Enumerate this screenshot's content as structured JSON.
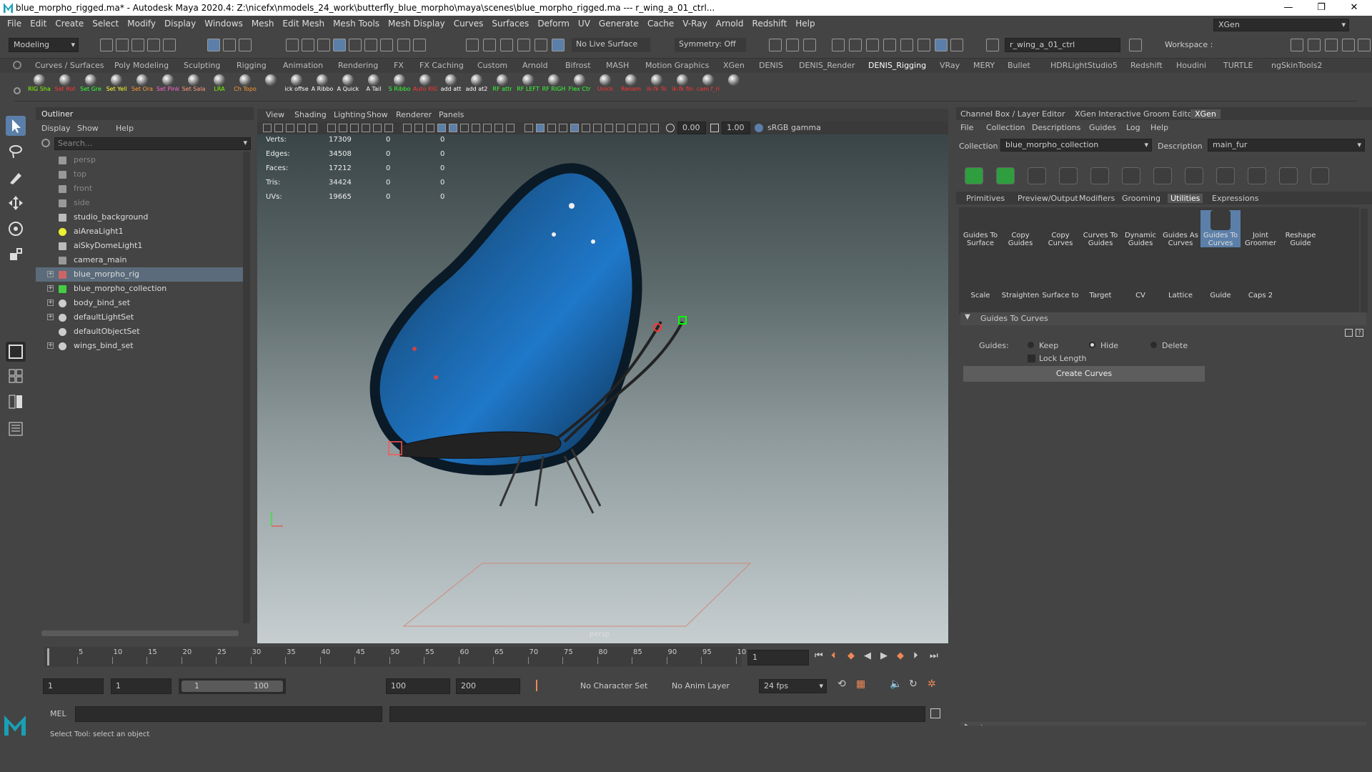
{
  "window": {
    "title": "blue_morpho_rigged.ma* - Autodesk Maya 2020.4: Z:\\nicefx\\nmodels_24_work\\butterfly_blue_morpho\\maya\\scenes\\blue_morpho_rigged.ma  ---  r_wing_a_01_ctrl...",
    "minimize": "—",
    "maximize": "❐",
    "close": "✕"
  },
  "menubar": {
    "items": [
      "File",
      "Edit",
      "Create",
      "Select",
      "Modify",
      "Display",
      "Windows",
      "Mesh",
      "Edit Mesh",
      "Mesh Tools",
      "Mesh Display",
      "Curves",
      "Surfaces",
      "Deform",
      "UV",
      "Generate",
      "Cache",
      "V-Ray",
      "Arnold",
      "Redshift",
      "Help"
    ],
    "workspace_label": "Workspace :",
    "workspace_value": "XGen"
  },
  "statusline": {
    "menuset": "Modeling",
    "live_surface": "No Live Surface",
    "symmetry": "Symmetry: Off",
    "selection_field": "r_wing_a_01_ctrl"
  },
  "shelf_tabs": [
    "Curves / Surfaces",
    "Poly Modeling",
    "Sculpting",
    "Rigging",
    "Animation",
    "Rendering",
    "FX",
    "FX Caching",
    "Custom",
    "Arnold",
    "Bifrost",
    "MASH",
    "Motion Graphics",
    "XGen",
    "DENIS",
    "DENIS_Render",
    "DENIS_Rigging",
    "VRay",
    "MERY",
    "Bullet",
    "HDRLightStudio5",
    "Redshift",
    "Houdini",
    "TURTLE",
    "ngSkinTools2"
  ],
  "shelf_active": "DENIS_Rigging",
  "shelf_buttons": [
    {
      "label": "RIG Sha",
      "color": "#7cfc00"
    },
    {
      "label": "Set Rot",
      "color": "#ff3333"
    },
    {
      "label": "Set Gre",
      "color": "#33ff33"
    },
    {
      "label": "Set Yell",
      "color": "#ffff33"
    },
    {
      "label": "Set Ora",
      "color": "#ff9933"
    },
    {
      "label": "Set Pink",
      "color": "#ff66cc"
    },
    {
      "label": "Set Sala",
      "color": "#ff9977"
    },
    {
      "label": "LRA",
      "color": "#7cfc00"
    },
    {
      "label": "Ch Topo",
      "color": "#ff9933"
    },
    {
      "label": "",
      "color": "#ffffff"
    },
    {
      "label": "ick offse",
      "color": "#ffffff"
    },
    {
      "label": "A Ribbo",
      "color": "#ffffff"
    },
    {
      "label": "A Quick",
      "color": "#ffffff"
    },
    {
      "label": "A Tail",
      "color": "#ffffff"
    },
    {
      "label": "S Ribbo",
      "color": "#33ff33"
    },
    {
      "label": "Auto RIG",
      "color": "#ff3333"
    },
    {
      "label": "add att",
      "color": "#ffffff"
    },
    {
      "label": "add at2",
      "color": "#ffffff"
    },
    {
      "label": "RF attr",
      "color": "#33ff33"
    },
    {
      "label": "RF LEFT",
      "color": "#33ff33"
    },
    {
      "label": "RF RIGH",
      "color": "#33ff33"
    },
    {
      "label": "Flex Ctr",
      "color": "#33ff33"
    },
    {
      "label": "Unlck",
      "color": "#ff3333"
    },
    {
      "label": "Renam",
      "color": "#ff3333"
    },
    {
      "label": "ik-fk To",
      "color": "#ff3333"
    },
    {
      "label": "ik-fk fin",
      "color": "#ff3333"
    },
    {
      "label": "cam f_ri",
      "color": "#ff3333"
    },
    {
      "label": "",
      "color": "#ffffff"
    }
  ],
  "outliner": {
    "title": "Outliner",
    "menu": [
      "Display",
      "Show",
      "Help"
    ],
    "search_placeholder": "Search...",
    "items": [
      {
        "label": "persp",
        "icon": "camera-icon",
        "dim": true,
        "expand": false
      },
      {
        "label": "top",
        "icon": "camera-icon",
        "dim": true,
        "expand": false
      },
      {
        "label": "front",
        "icon": "camera-icon",
        "dim": true,
        "expand": false
      },
      {
        "label": "side",
        "icon": "camera-icon",
        "dim": true,
        "expand": false
      },
      {
        "label": "studio_background",
        "icon": "mesh-icon",
        "dim": false,
        "expand": false
      },
      {
        "label": "aiAreaLight1",
        "icon": "light-icon",
        "dim": false,
        "expand": false
      },
      {
        "label": "aiSkyDomeLight1",
        "icon": "dome-light-icon",
        "dim": false,
        "expand": false
      },
      {
        "label": "camera_main",
        "icon": "camera-icon",
        "dim": false,
        "expand": false
      },
      {
        "label": "blue_morpho_rig",
        "icon": "rig-icon",
        "dim": false,
        "expand": true,
        "selected": true
      },
      {
        "label": "blue_morpho_collection",
        "icon": "xgen-icon",
        "dim": false,
        "expand": true
      },
      {
        "label": "body_bind_set",
        "icon": "set-icon",
        "dim": false,
        "expand": true
      },
      {
        "label": "defaultLightSet",
        "icon": "set-icon",
        "dim": false,
        "expand": true
      },
      {
        "label": "defaultObjectSet",
        "icon": "set-icon",
        "dim": false,
        "expand": false
      },
      {
        "label": "wings_bind_set",
        "icon": "set-icon",
        "dim": false,
        "expand": true
      }
    ]
  },
  "viewport": {
    "menu": [
      "View",
      "Shading",
      "Lighting",
      "Show",
      "Renderer",
      "Panels"
    ],
    "exposure": "0.00",
    "gamma": "1.00",
    "colorspace": "sRGB gamma",
    "camera_label": "persp",
    "hud": [
      {
        "label": "Verts:",
        "a": "17309",
        "b": "0",
        "c": "0"
      },
      {
        "label": "Edges:",
        "a": "34508",
        "b": "0",
        "c": "0"
      },
      {
        "label": "Faces:",
        "a": "17212",
        "b": "0",
        "c": "0"
      },
      {
        "label": "Tris:",
        "a": "34424",
        "b": "0",
        "c": "0"
      },
      {
        "label": "UVs:",
        "a": "19665",
        "b": "0",
        "c": "0"
      }
    ]
  },
  "right_panel": {
    "tabs": [
      "Channel Box / Layer Editor",
      "XGen Interactive Groom Editor",
      "XGen"
    ],
    "active_tab": "XGen",
    "menu": [
      "File",
      "Collection",
      "Descriptions",
      "Guides",
      "Log",
      "Help"
    ],
    "collection_label": "Collection",
    "collection_value": "blue_morpho_collection",
    "description_label": "Description",
    "description_value": "main_fur",
    "subtabs": [
      "Primitives",
      "Preview/Output",
      "Modifiers",
      "Grooming",
      "Utilities",
      "Expressions"
    ],
    "active_subtab": "Utilities",
    "utilities_row1": [
      {
        "line1": "Guides To",
        "line2": "Surface"
      },
      {
        "line1": "Copy",
        "line2": "Guides"
      },
      {
        "line1": "Copy",
        "line2": "Curves"
      },
      {
        "line1": "Curves To",
        "line2": "Guides"
      },
      {
        "line1": "Dynamic",
        "line2": "Guides"
      },
      {
        "line1": "Guides As",
        "line2": "Curves"
      },
      {
        "line1": "Guides To",
        "line2": "Curves"
      },
      {
        "line1": "Joint",
        "line2": "Groomer"
      },
      {
        "line1": "Reshape",
        "line2": "Guide"
      }
    ],
    "utilities_row2": [
      {
        "line1": "",
        "line2": "Scale"
      },
      {
        "line1": "",
        "line2": "Straighten"
      },
      {
        "line1": "",
        "line2": "Surface to"
      },
      {
        "line1": "",
        "line2": "Target"
      },
      {
        "line1": "",
        "line2": "CV"
      },
      {
        "line1": "",
        "line2": "Lattice"
      },
      {
        "line1": "",
        "line2": "Guide"
      },
      {
        "line1": "",
        "line2": "Caps 2"
      }
    ],
    "section_title": "Guides To Curves",
    "guides_label": "Guides:",
    "opt_keep": "Keep",
    "opt_hide": "Hide",
    "opt_delete": "Delete",
    "lock_length": "Lock Length",
    "create_button": "Create Curves",
    "log_label": "Log"
  },
  "timeline": {
    "ticks": [
      "5",
      "10",
      "15",
      "20",
      "25",
      "30",
      "35",
      "40",
      "45",
      "50",
      "55",
      "60",
      "65",
      "70",
      "75",
      "80",
      "85",
      "90",
      "95",
      "10"
    ],
    "current_frame": "1"
  },
  "range": {
    "start": "1",
    "start2": "1",
    "slider_min": "1",
    "slider_max": "100",
    "end": "100",
    "end2": "200",
    "character_set": "No Character Set",
    "anim_layer": "No Anim Layer",
    "fps": "24 fps"
  },
  "cmdline": {
    "lang": "MEL"
  },
  "helpline": {
    "text": "Select Tool: select an object"
  }
}
